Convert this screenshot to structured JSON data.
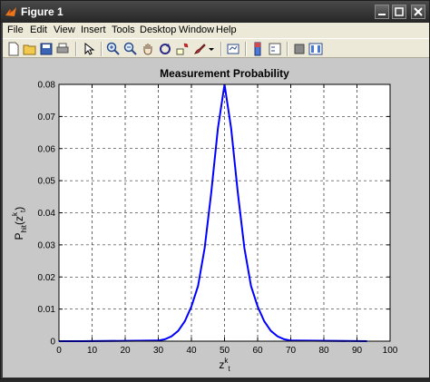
{
  "window": {
    "title": "Figure 1"
  },
  "menubar": {
    "items": [
      "File",
      "Edit",
      "View",
      "Insert",
      "Tools",
      "Desktop",
      "Window",
      "Help"
    ]
  },
  "toolbar": {
    "icons": [
      "new-figure-icon",
      "open-file-icon",
      "save-icon",
      "print-icon",
      "edit-plot-arrow-icon",
      "zoom-in-icon",
      "zoom-out-icon",
      "pan-hand-icon",
      "rotate-3d-icon",
      "data-cursor-icon",
      "brush-icon",
      "link-plot-icon",
      "colorbar-icon",
      "legend-icon",
      "hide-plot-tools-icon",
      "show-plot-tools-icon"
    ]
  },
  "chart_data": {
    "type": "line",
    "title": "Measurement Probability",
    "xlabel": "z",
    "xlabel_sup": "k",
    "xlabel_sub": "t",
    "ylabel": "P",
    "ylabel_sub": "hit",
    "ylabel_arg": "(z",
    "ylabel_arg_sup": "k",
    "ylabel_arg_sub": "t",
    "ylabel_close": ")",
    "xlim": [
      0,
      100
    ],
    "ylim": [
      0,
      0.08
    ],
    "xticks": [
      "0",
      "10",
      "20",
      "30",
      "40",
      "50",
      "60",
      "70",
      "80",
      "90",
      "100"
    ],
    "yticks": [
      "0",
      "0.01",
      "0.02",
      "0.03",
      "0.04",
      "0.05",
      "0.06",
      "0.07",
      "0.08"
    ],
    "grid": true,
    "line_color": "#0000ff",
    "series": [
      {
        "x": [
          0,
          7,
          30,
          32,
          34,
          36,
          38,
          40,
          42,
          44,
          46,
          48,
          50,
          52,
          54,
          56,
          58,
          60,
          62,
          64,
          66,
          68,
          70,
          93
        ],
        "y": [
          0,
          0,
          0.0002,
          0.0006,
          0.0015,
          0.0032,
          0.0062,
          0.0108,
          0.0172,
          0.029,
          0.0464,
          0.0663,
          0.08,
          0.0663,
          0.0464,
          0.029,
          0.0172,
          0.0108,
          0.0062,
          0.0032,
          0.0015,
          0.0006,
          0.0002,
          0
        ]
      }
    ]
  },
  "colors": {
    "figure_bg": "#c8c8c8",
    "axes_bg": "#ffffff",
    "menu_bg": "#ece9d8",
    "titlebar": "#262626"
  }
}
